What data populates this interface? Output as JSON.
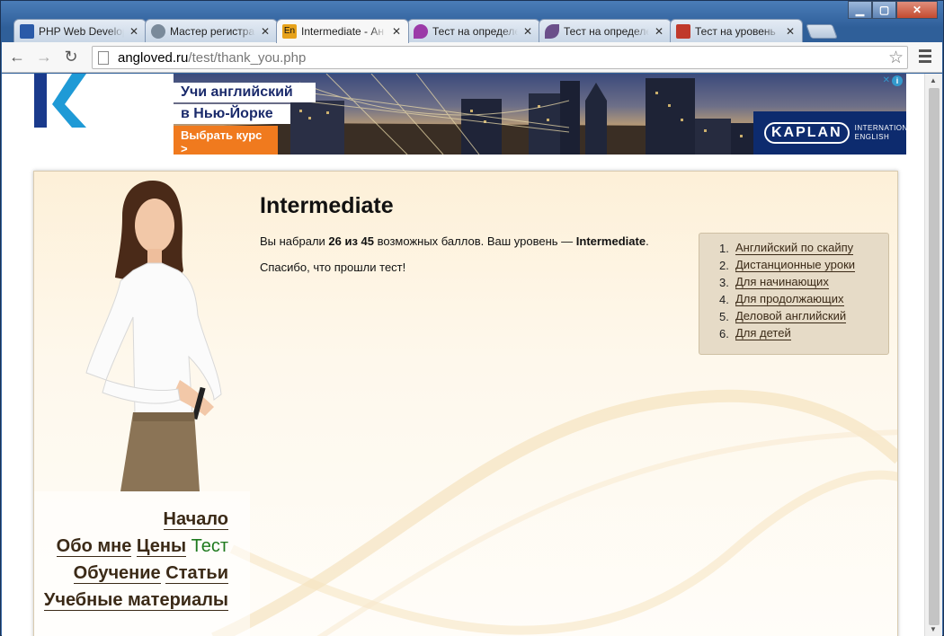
{
  "window": {
    "minimize": "▁",
    "maximize": "▢",
    "close": "✕"
  },
  "tabs": [
    {
      "title": "PHP Web Develop",
      "color": "#2a5aa8",
      "active": false
    },
    {
      "title": "Мастер регистра",
      "color": "#7a8a9a",
      "active": false
    },
    {
      "title": "Intermediate - Ан",
      "color": "#e7a21a",
      "active": true
    },
    {
      "title": "Тест на определе",
      "color": "#9b3aa8",
      "active": false
    },
    {
      "title": "Тест на определе",
      "color": "#6b4f8a",
      "active": false
    },
    {
      "title": "Тест на уровень",
      "color": "#c0392b",
      "active": false
    }
  ],
  "tab_close": "✕",
  "toolbar": {
    "back": "←",
    "forward": "→",
    "reload": "↻",
    "bookmark": "☆"
  },
  "address": {
    "host": "angloved.ru",
    "path": "/test/thank_you.php"
  },
  "ad": {
    "line1": "Учи английский",
    "line2": "в Нью-Йорке",
    "cta": "Выбрать курс >",
    "brand": "KAPLAN",
    "brand_sub1": "INTERNATIONAL",
    "brand_sub2": "ENGLISH",
    "info": "i",
    "close": "✕"
  },
  "content": {
    "title": "Intermediate",
    "result_pre": "Вы набрали ",
    "score": "26 из 45",
    "result_mid": " возможных баллов. Ваш уровень — ",
    "level": "Intermediate",
    "result_end": ".",
    "thanks": "Спасибо, что прошли тест!"
  },
  "sidebar": {
    "items": [
      {
        "num": "1.",
        "label": "Английский по скайпу"
      },
      {
        "num": "2.",
        "label": "Дистанционные уроки"
      },
      {
        "num": "3.",
        "label": "Для начинающих"
      },
      {
        "num": "4.",
        "label": "Для продолжающих"
      },
      {
        "num": "5.",
        "label": "Деловой английский"
      },
      {
        "num": "6.",
        "label": "Для детей"
      }
    ]
  },
  "nav": {
    "home": "Начало",
    "about": "Обо мне",
    "prices": "Цены",
    "test": "Тест",
    "learning": "Обучение",
    "articles": "Статьи",
    "materials": "Учебные материалы"
  },
  "colors": {
    "link": "#3b2a17",
    "current_nav": "#1f7a1f",
    "logo": "#1a3a8c",
    "cta": "#f07a1e",
    "kaplan": "#0d2b6e"
  }
}
